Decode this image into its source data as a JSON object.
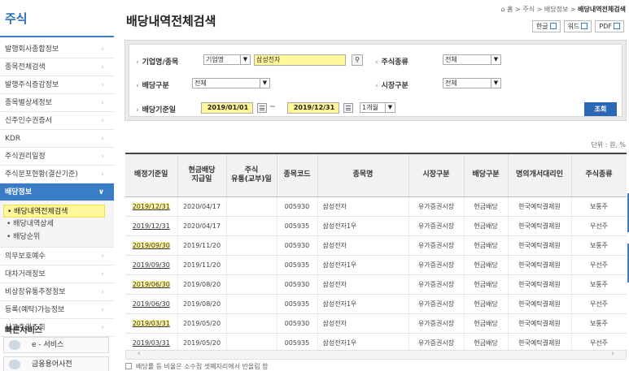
{
  "sidebar": {
    "title": "주식",
    "items": [
      {
        "label": "발행회사종합정보"
      },
      {
        "label": "종목전체검색"
      },
      {
        "label": "발행주식증감정보"
      },
      {
        "label": "종목별상세정보"
      },
      {
        "label": "신주인수권증서"
      },
      {
        "label": "KDR"
      },
      {
        "label": "주식권리일정"
      },
      {
        "label": "주식분포현황(결산기준)"
      },
      {
        "label": "배당정보"
      }
    ],
    "sub_items": [
      {
        "label": "• 배당내역전체검색"
      },
      {
        "label": "• 배당내역상세"
      },
      {
        "label": "• 배당순위"
      }
    ],
    "items_after": [
      {
        "label": "의무보호예수"
      },
      {
        "label": "대차거래정보"
      },
      {
        "label": "비상장유통추정정보"
      },
      {
        "label": "등록(예탁)가능정보"
      },
      {
        "label": "사고주권조회"
      }
    ],
    "quick_title": "빠른서비스",
    "quick_items": [
      {
        "label": "e - 서비스"
      },
      {
        "label": "금융용어사전"
      }
    ]
  },
  "header": {
    "title": "배당내역전체검색",
    "breadcrumb": [
      "홈",
      "주식",
      "배당정보",
      "배당내역전체검색"
    ],
    "breadcrumb_sep": ">",
    "buttons": {
      "hangul": "한글",
      "word": "워드",
      "pdf": "PDF"
    }
  },
  "search": {
    "company_label": "기업명/종목",
    "company_type": "기업명",
    "company_value": "삼성전자",
    "stock_type_label": "주식종류",
    "stock_type_value": "전체",
    "dividend_type_label": "배당구분",
    "dividend_type_value": "전체",
    "market_label": "시장구분",
    "market_value": "전체",
    "date_label": "배당기준일",
    "date_from": "2019/01/01",
    "date_to": "2019/12/31",
    "tilde": "~",
    "period": "1개월",
    "submit": "조회"
  },
  "unit": "단위 : 원, %",
  "table": {
    "headers": [
      "배정기준일",
      "현금배당\n지급일",
      "주식\n유통(교부)일",
      "종목코드",
      "종목명",
      "시장구분",
      "배당구분",
      "명의개서대리인",
      "주식종류"
    ],
    "rows": [
      [
        "2019/12/31",
        "2020/04/17",
        "",
        "005930",
        "삼성전자",
        "유가증권시장",
        "현금배당",
        "한국예탁결제원",
        "보통주"
      ],
      [
        "2019/12/31",
        "2020/04/17",
        "",
        "005935",
        "삼성전자1우",
        "유가증권시장",
        "현금배당",
        "한국예탁결제원",
        "우선주"
      ],
      [
        "2019/09/30",
        "2019/11/20",
        "",
        "005930",
        "삼성전자",
        "유가증권시장",
        "현금배당",
        "한국예탁결제원",
        "보통주"
      ],
      [
        "2019/09/30",
        "2019/11/20",
        "",
        "005935",
        "삼성전자1우",
        "유가증권시장",
        "현금배당",
        "한국예탁결제원",
        "우선주"
      ],
      [
        "2019/06/30",
        "2019/08/20",
        "",
        "005930",
        "삼성전자",
        "유가증권시장",
        "현금배당",
        "한국예탁결제원",
        "보통주"
      ],
      [
        "2019/06/30",
        "2019/08/20",
        "",
        "005935",
        "삼성전자1우",
        "유가증권시장",
        "현금배당",
        "한국예탁결제원",
        "우선주"
      ],
      [
        "2019/03/31",
        "2019/05/20",
        "",
        "005930",
        "삼성전자",
        "유가증권시장",
        "현금배당",
        "한국예탁결제원",
        "보통주"
      ],
      [
        "2019/03/31",
        "2019/05/20",
        "",
        "005935",
        "삼성전자1우",
        "유가증권시장",
        "현금배당",
        "한국예탁결제원",
        "우선주"
      ]
    ],
    "highlight_rows": [
      0,
      2,
      4,
      6
    ]
  },
  "note": "배당률 등 비율은 소수점 셋째자리에서 반올림 함",
  "colors": {
    "accent": "#3a7cc5",
    "highlight": "#fff799",
    "button": "#2c67b5"
  }
}
